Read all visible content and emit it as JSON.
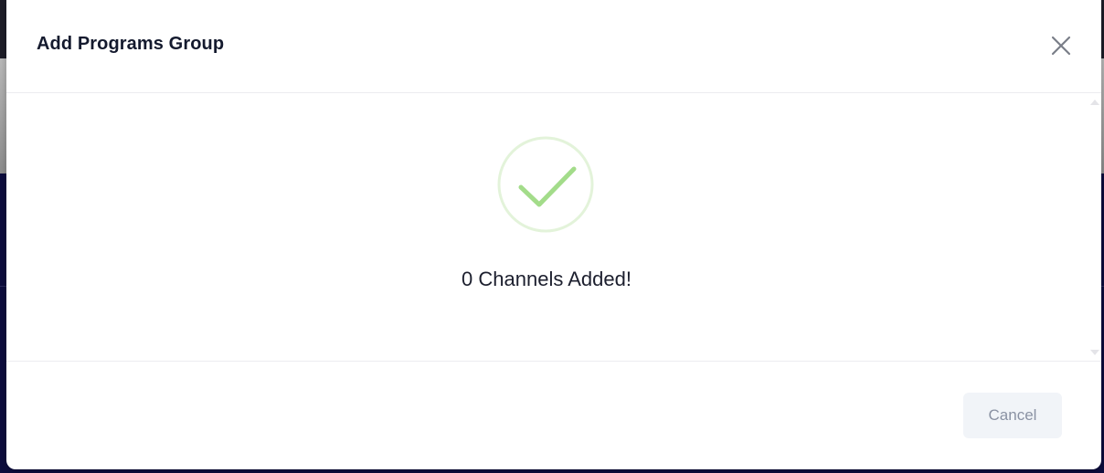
{
  "modal": {
    "title": "Add Programs Group",
    "close_icon": "close-icon",
    "success_icon": "check-circle-icon",
    "message": "0 Channels Added!",
    "cancel_label": "Cancel"
  },
  "colors": {
    "success": "#a3dc8a",
    "success_ring": "#e3f3da",
    "title": "#141a2e",
    "cancel_bg": "#f1f4f8",
    "cancel_text": "#8a92a3"
  }
}
